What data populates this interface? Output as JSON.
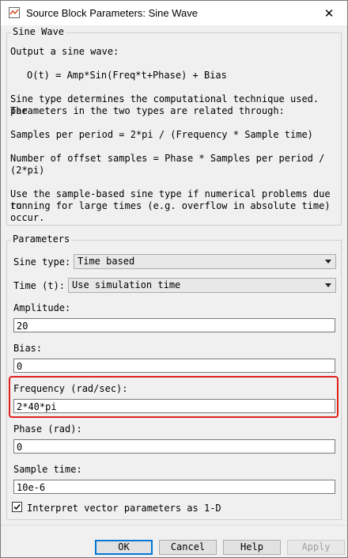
{
  "window": {
    "title": "Source Block Parameters: Sine Wave"
  },
  "block": {
    "group_title": "Sine Wave",
    "description": [
      "Output a sine wave:",
      "O(t) = Amp*Sin(Freq*t+Phase) + Bias",
      "Sine type determines the computational technique used. The",
      "parameters in the two types are related through:",
      "Samples per period = 2*pi / (Frequency * Sample time)",
      "Number of offset samples = Phase * Samples per period /",
      "(2*pi)",
      "Use the sample-based sine type if numerical problems due to",
      "running for large times (e.g. overflow in absolute time)",
      "occur."
    ]
  },
  "parameters": {
    "group_title": "Parameters",
    "sine_type": {
      "label": "Sine type:",
      "value": "Time based"
    },
    "time": {
      "label": "Time (t):",
      "value": "Use simulation time"
    },
    "amplitude": {
      "label": "Amplitude:",
      "value": "20"
    },
    "bias": {
      "label": "Bias:",
      "value": "0"
    },
    "frequency": {
      "label": "Frequency (rad/sec):",
      "value": "2*40*pi"
    },
    "phase": {
      "label": "Phase (rad):",
      "value": "0"
    },
    "sample_time": {
      "label": "Sample time:",
      "value": "10e-6"
    },
    "interpret_vector": {
      "label": "Interpret vector parameters as 1-D",
      "checked": true
    }
  },
  "buttons": {
    "ok": "OK",
    "cancel": "Cancel",
    "help": "Help",
    "apply": "Apply"
  },
  "colors": {
    "highlight": "#e0201c",
    "default_button_border": "#0078d7"
  }
}
